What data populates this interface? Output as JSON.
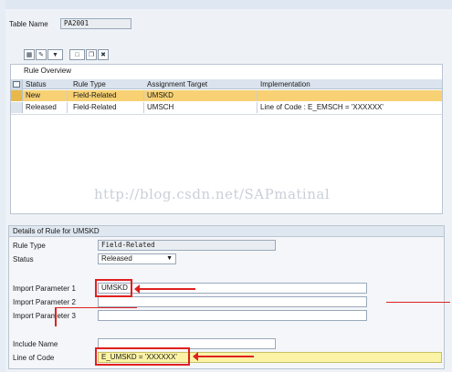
{
  "header": {
    "table_name_label": "Table Name",
    "table_name_value": "PA2001"
  },
  "toolbar": {
    "icons": [
      "details-icon",
      "change-icon",
      "filter-icon",
      "create-icon",
      "copy-icon",
      "delete-icon"
    ]
  },
  "rule_overview": {
    "title": "Rule Overview",
    "columns": [
      "Status",
      "Rule Type",
      "Assignment Target",
      "Implementation"
    ],
    "rows": [
      {
        "status": "New",
        "rule_type": "Field-Related",
        "target": "UMSKD",
        "implementation": ""
      },
      {
        "status": "Released",
        "rule_type": "Field-Related",
        "target": "UMSCH",
        "implementation": "Line of Code : E_EMSCH = 'XXXXXX'"
      }
    ]
  },
  "watermark": "http://blog.csdn.net/SAPmatinal",
  "details": {
    "title": "Details of Rule for UMSKD",
    "rule_type_label": "Rule Type",
    "rule_type_value": "Field-Related",
    "status_label": "Status",
    "status_value": "Released",
    "import_param1_label": "Import Parameter 1",
    "import_param1_value": "UMSKD",
    "import_param2_label": "Import Parameter 2",
    "import_param2_value": "",
    "import_param3_label": "Import Parameter 3",
    "import_param3_value": "",
    "include_name_label": "Include Name",
    "include_name_value": "",
    "line_of_code_label": "Line of Code",
    "line_of_code_value": "E_UMSKD = 'XXXXXX'"
  },
  "colors": {
    "selected_row": "#f7d174",
    "annotation_red": "#e02020",
    "code_field": "#fbf3a6"
  }
}
